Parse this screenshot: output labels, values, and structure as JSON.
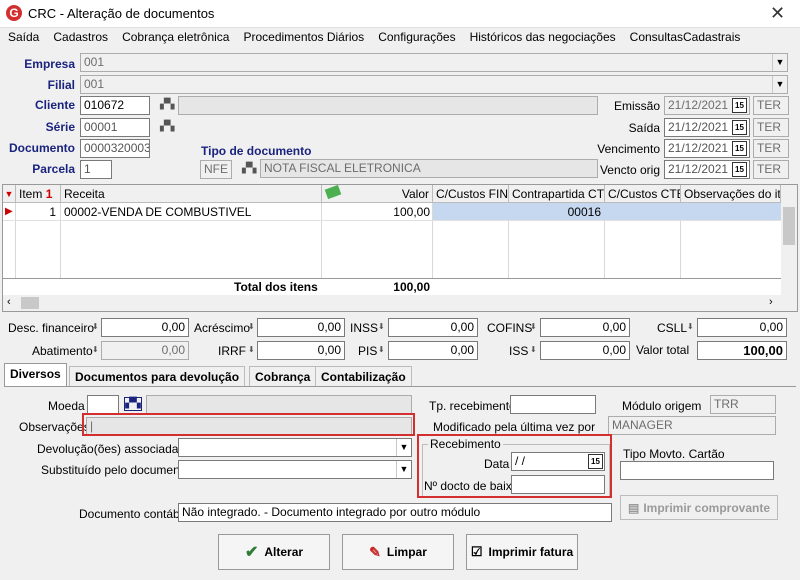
{
  "window": {
    "title": "CRC - Alteração de documentos",
    "logo": "G"
  },
  "menu": [
    "Saída",
    "Cadastros",
    "Cobrança eletrônica",
    "Procedimentos Diários",
    "Configurações",
    "Históricos das negociações",
    "ConsultasCadastrais"
  ],
  "header": {
    "empresa_label": "Empresa",
    "empresa_value": "001",
    "filial_label": "Filial",
    "filial_value": "001",
    "cliente_label": "Cliente",
    "cliente_value": "010672",
    "serie_label": "Série",
    "serie_value": "00001",
    "documento_label": "Documento",
    "documento_value": "0000320003",
    "parcela_label": "Parcela",
    "parcela_value": "1",
    "tipo_doc_label": "Tipo de documento",
    "tipo_doc_code": "NFE",
    "tipo_doc_desc": "NOTA FISCAL ELETRONICA",
    "emissao_label": "Emissão",
    "emissao_value": "21/12/2021",
    "emissao_day": "TER",
    "saida_label": "Saída",
    "saida_value": "21/12/2021",
    "saida_day": "TER",
    "vencimento_label": "Vencimento",
    "vencimento_value": "21/12/2021",
    "vencimento_day": "TER",
    "vencto_orig_label": "Vencto orig",
    "vencto_orig_value": "21/12/2021",
    "vencto_orig_day": "TER",
    "cal_icon": "15"
  },
  "grid": {
    "headers": [
      "Item",
      "Receita",
      "Valor",
      "C/Custos FIN",
      "Contrapartida CTB",
      "C/Custos CTB",
      "Observações do item"
    ],
    "sort_indicator": "1",
    "rows": [
      {
        "item": "1",
        "receita": "00002-VENDA DE COMBUSTIVEL",
        "valor": "100,00",
        "ccfin": "",
        "contrapartida": "00016",
        "ccctb": "",
        "obs": ""
      }
    ],
    "total_label": "Total dos itens",
    "total_value": "100,00"
  },
  "totals": {
    "desc_fin_label": "Desc. financeiro",
    "desc_fin": "0,00",
    "acrescimo_label": "Acréscimo",
    "acrescimo": "0,00",
    "inss_label": "INSS",
    "inss": "0,00",
    "cofins_label": "COFINS",
    "cofins": "0,00",
    "csll_label": "CSLL",
    "csll": "0,00",
    "abatimento_label": "Abatimento",
    "abatimento": "0,00",
    "irrf_label": "IRRF",
    "irrf": "0,00",
    "pis_label": "PIS",
    "pis": "0,00",
    "iss_label": "ISS",
    "iss": "0,00",
    "valor_total_label": "Valor total",
    "valor_total": "100,00"
  },
  "tabs": [
    "Diversos",
    "Documentos para devolução",
    "Cobrança",
    "Contabilização"
  ],
  "diversos": {
    "moeda_label": "Moeda",
    "observacoes_label": "Observações",
    "devolucao_label": "Devolução(ões) associada(s)",
    "substituido_label": "Substituído pelo documento",
    "tp_recebimento_label": "Tp. recebimento",
    "modulo_origem_label": "Módulo origem",
    "modulo_origem_value": "TRR",
    "modificado_label": "Modificado pela última vez por",
    "modificado_value": "MANAGER",
    "recebimento_group": "Recebimento",
    "data_label": "Data",
    "data_value": " /  /",
    "docto_baixa_label": "Nº docto de baixa",
    "tipo_movto_label": "Tipo Movto. Cartão",
    "doc_contabil_label": "Documento contábil",
    "doc_contabil_value": "Não integrado.  - Documento integrado por outro módulo",
    "imprimir_comprovante": "Imprimir comprovante"
  },
  "buttons": {
    "alterar": "Alterar",
    "limpar": "Limpar",
    "imprimir_fatura": "Imprimir fatura"
  },
  "colors": {
    "highlight_box": "#d32f2f",
    "label_blue": "#1a237e",
    "selected_cell": "#c5d8f0"
  }
}
